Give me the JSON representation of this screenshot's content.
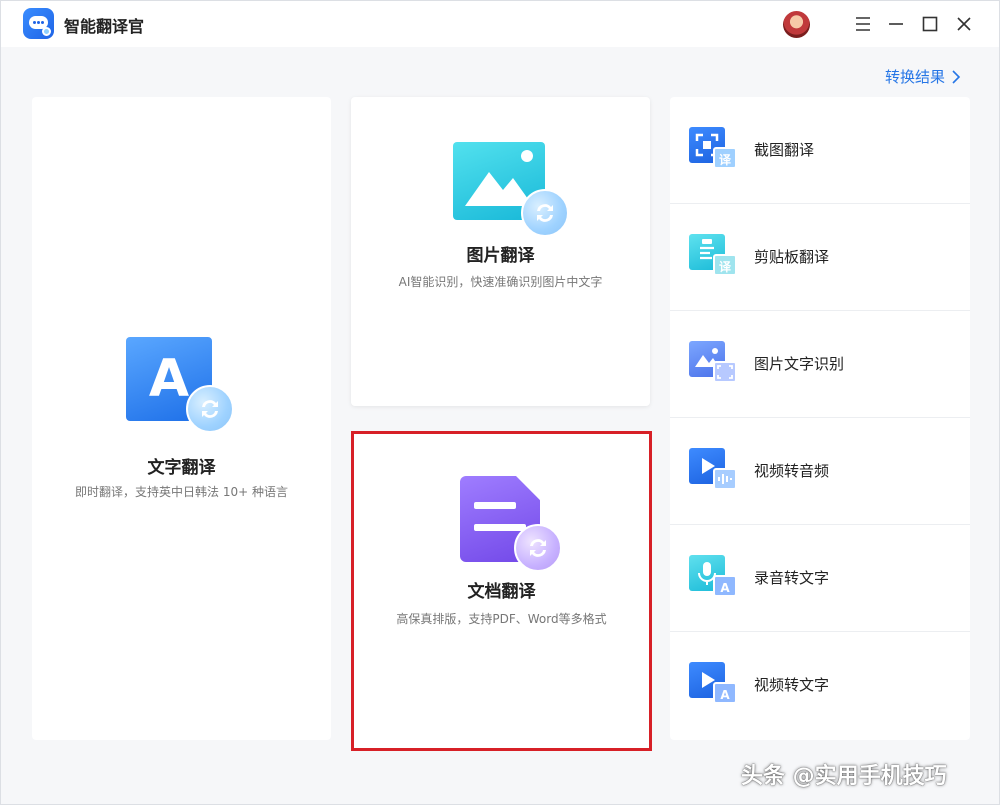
{
  "app": {
    "title": "智能翻译官"
  },
  "header": {
    "result_link": "转换结果"
  },
  "cards": {
    "text": {
      "title": "文字翻译",
      "desc": "即时翻译，支持英中日韩法 10+ 种语言",
      "icon_letter": "A"
    },
    "image": {
      "title": "图片翻译",
      "desc": "AI智能识别，快速准确识别图片中文字"
    },
    "doc": {
      "title": "文档翻译",
      "desc": "高保真排版，支持PDF、Word等多格式"
    }
  },
  "tools": [
    {
      "label": "截图翻译",
      "badge": "译",
      "icon": "screenshot-translate-icon"
    },
    {
      "label": "剪贴板翻译",
      "badge": "译",
      "icon": "clipboard-translate-icon"
    },
    {
      "label": "图片文字识别",
      "badge": "",
      "icon": "image-ocr-icon"
    },
    {
      "label": "视频转音频",
      "badge": "",
      "icon": "video-to-audio-icon"
    },
    {
      "label": "录音转文字",
      "badge": "A",
      "icon": "audio-to-text-icon"
    },
    {
      "label": "视频转文字",
      "badge": "A",
      "icon": "video-to-text-icon"
    }
  ],
  "watermark": "头条 @实用手机技巧",
  "colors": {
    "accent": "#2676e6",
    "highlight_border": "#d72027",
    "image_icon": "#18b8d8",
    "doc_icon": "#7248e8"
  }
}
